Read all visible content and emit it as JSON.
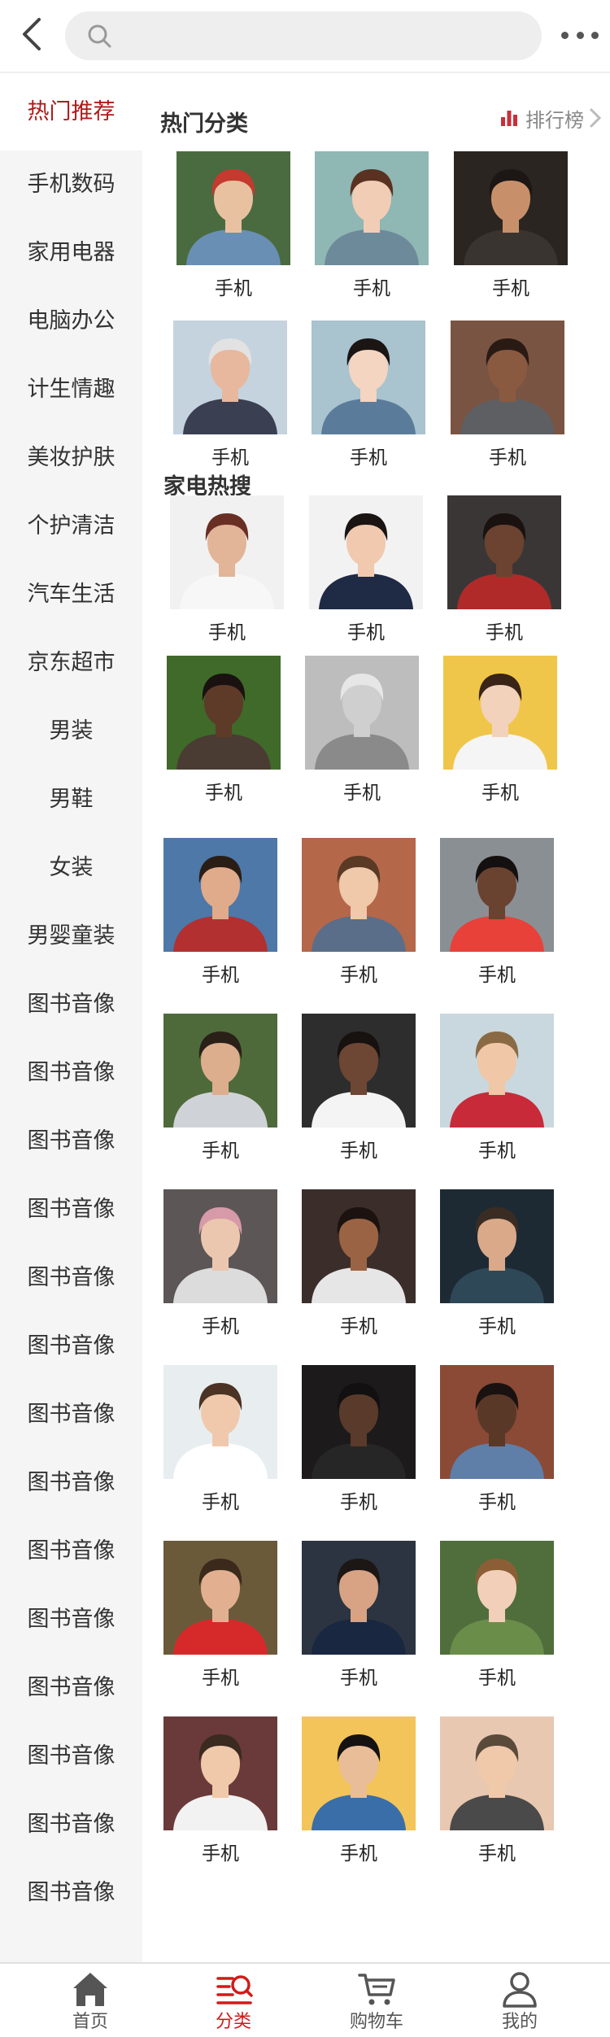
{
  "search": {
    "placeholder": ""
  },
  "colors": {
    "accent": "#b1191a",
    "tab_active": "#d01a1a",
    "sidebar_bg": "#f5f5f5"
  },
  "sidebar": {
    "items": [
      {
        "label": "热门推荐",
        "active": true
      },
      {
        "label": "手机数码"
      },
      {
        "label": "家用电器"
      },
      {
        "label": "电脑办公"
      },
      {
        "label": "计生情趣"
      },
      {
        "label": "美妆护肤"
      },
      {
        "label": "个护清洁"
      },
      {
        "label": "汽车生活"
      },
      {
        "label": "京东超市"
      },
      {
        "label": "男装"
      },
      {
        "label": "男鞋"
      },
      {
        "label": "女装"
      },
      {
        "label": "男婴童装"
      },
      {
        "label": "图书音像"
      },
      {
        "label": "图书音像"
      },
      {
        "label": "图书音像"
      },
      {
        "label": "图书音像"
      },
      {
        "label": "图书音像"
      },
      {
        "label": "图书音像"
      },
      {
        "label": "图书音像"
      },
      {
        "label": "图书音像"
      },
      {
        "label": "图书音像"
      },
      {
        "label": "图书音像"
      },
      {
        "label": "图书音像"
      },
      {
        "label": "图书音像"
      },
      {
        "label": "图书音像"
      },
      {
        "label": "图书音像"
      }
    ]
  },
  "hot": {
    "title": "热门分类",
    "rank_label": "排行榜",
    "items": [
      {
        "label": "手机",
        "bg": "#4a6b3f",
        "skin": "#e8c2a0",
        "hair": "#c43a2f",
        "shirt": "#6a8fb5"
      },
      {
        "label": "手机",
        "bg": "#8fb7b4",
        "skin": "#f1cdb6",
        "hair": "#5a3222",
        "shirt": "#6d8a9a"
      },
      {
        "label": "手机",
        "bg": "#2a2521",
        "skin": "#c8906a",
        "hair": "#1c1714",
        "shirt": "#3a3430"
      },
      {
        "label": "手机",
        "bg": "#c5d3de",
        "skin": "#e7b89d",
        "hair": "#e2e2e2",
        "shirt": "#3a3f52"
      },
      {
        "label": "手机",
        "bg": "#a9c3cf",
        "skin": "#f3d5c2",
        "hair": "#1b1514",
        "shirt": "#5a7c9a"
      },
      {
        "label": "手机",
        "bg": "#7a5442",
        "skin": "#8a5a40",
        "hair": "#2a1a14",
        "shirt": "#5d5f63"
      },
      {
        "label": "手机",
        "bg": "#f1f1f1",
        "skin": "#e2b598",
        "hair": "#6a2f24",
        "shirt": "#f7f7f7"
      },
      {
        "label": "手机",
        "bg": "#f2f2f2",
        "skin": "#f0c9ae",
        "hair": "#1a1412",
        "shirt": "#1f2a44"
      },
      {
        "label": "手机",
        "bg": "#3b3636",
        "skin": "#6b4330",
        "hair": "#1a1210",
        "shirt": "#b02a2a"
      }
    ]
  },
  "appliance": {
    "title": "家电热搜",
    "items": [
      {
        "label": "手机",
        "bg": "#3f6a2a",
        "skin": "#5e3a28",
        "hair": "#1a1210",
        "shirt": "#4a3b33"
      },
      {
        "label": "手机",
        "bg": "#bdbdbd",
        "skin": "#cfcfcf",
        "hair": "#e6e6e6",
        "shirt": "#8a8a8a"
      },
      {
        "label": "手机",
        "bg": "#f0c64a",
        "skin": "#f2d2bb",
        "hair": "#3a2418",
        "shirt": "#f5f5f5"
      },
      {
        "label": "手机",
        "bg": "#4d78a8",
        "skin": "#e0ab8b",
        "hair": "#2a1d16",
        "shirt": "#b23030"
      },
      {
        "label": "手机",
        "bg": "#b5674a",
        "skin": "#f0c8aa",
        "hair": "#5a3a24",
        "shirt": "#5a6e8a"
      },
      {
        "label": "手机",
        "bg": "#8a8f94",
        "skin": "#6a4230",
        "hair": "#141010",
        "shirt": "#e8413a"
      },
      {
        "label": "手机",
        "bg": "#4e6a3a",
        "skin": "#dcae8d",
        "hair": "#2a2018",
        "shirt": "#cfd3d8"
      },
      {
        "label": "手机",
        "bg": "#2d2d2d",
        "skin": "#6e4634",
        "hair": "#171110",
        "shirt": "#f4f4f4"
      },
      {
        "label": "手机",
        "bg": "#c9d8de",
        "skin": "#f0c7a7",
        "hair": "#8a6a44",
        "shirt": "#c82a3a"
      },
      {
        "label": "手机",
        "bg": "#5d5656",
        "skin": "#ecc7b0",
        "hair": "#d69aa8",
        "shirt": "#dcdcdc"
      },
      {
        "label": "手机",
        "bg": "#3b2e2a",
        "skin": "#9a6444",
        "hair": "#1c1210",
        "shirt": "#e6e6e6"
      },
      {
        "label": "手机",
        "bg": "#1e2a33",
        "skin": "#d9a98a",
        "hair": "#3a2c22",
        "shirt": "#2f4858"
      },
      {
        "label": "手机",
        "bg": "#e8eef0",
        "skin": "#f0c9ad",
        "hair": "#4a3224",
        "shirt": "#ffffff"
      },
      {
        "label": "手机",
        "bg": "#1c1a1a",
        "skin": "#5a3a2a",
        "hair": "#121010",
        "shirt": "#262626"
      },
      {
        "label": "手机",
        "bg": "#8a4a36",
        "skin": "#5a3828",
        "hair": "#1a1210",
        "shirt": "#5f7ea8"
      },
      {
        "label": "手机",
        "bg": "#6a5a3a",
        "skin": "#e2b090",
        "hair": "#3b2a1c",
        "shirt": "#d62a2a"
      },
      {
        "label": "手机",
        "bg": "#2b3440",
        "skin": "#d8a284",
        "hair": "#1c1614",
        "shirt": "#1a2740"
      },
      {
        "label": "手机",
        "bg": "#4f6e3c",
        "skin": "#f1cfb8",
        "hair": "#8c5e36",
        "shirt": "#6a8e4a"
      },
      {
        "label": "手机",
        "bg": "#6a3a3a",
        "skin": "#f0c8aa",
        "hair": "#3a2a20",
        "shirt": "#f2f2f2"
      },
      {
        "label": "手机",
        "bg": "#f2c45a",
        "skin": "#e8bd98",
        "hair": "#161212",
        "shirt": "#3a6ea8"
      },
      {
        "label": "手机",
        "bg": "#e8c8b0",
        "skin": "#f0c8aa",
        "hair": "#5a4a3a",
        "shirt": "#4a4a4a"
      }
    ]
  },
  "tabbar": {
    "items": [
      {
        "label": "首页",
        "icon": "home-icon"
      },
      {
        "label": "分类",
        "icon": "category-icon",
        "active": true
      },
      {
        "label": "购物车",
        "icon": "cart-icon"
      },
      {
        "label": "我的",
        "icon": "profile-icon"
      }
    ]
  }
}
